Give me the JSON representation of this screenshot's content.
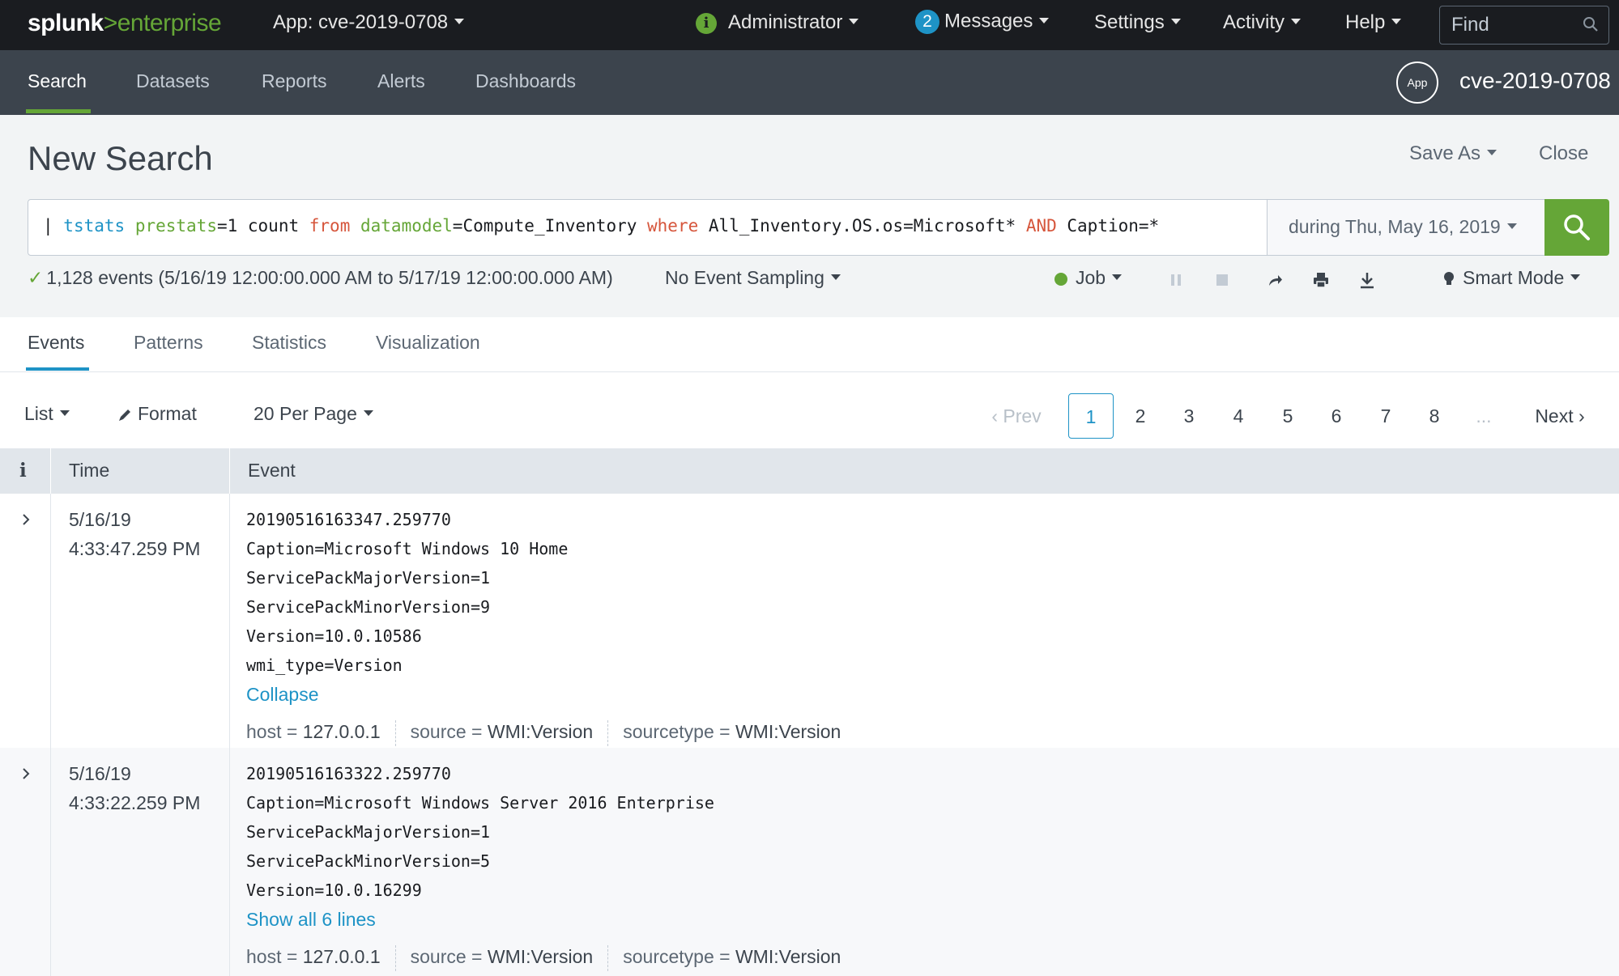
{
  "topbar": {
    "logo_splunk": "splunk",
    "logo_gt": ">",
    "logo_enterprise": "enterprise",
    "app_menu": "App: cve-2019-0708",
    "admin_label": "Administrator",
    "messages_count": "2",
    "messages_label": "Messages",
    "settings_label": "Settings",
    "activity_label": "Activity",
    "help_label": "Help",
    "find_placeholder": "Find"
  },
  "nav": {
    "items": [
      "Search",
      "Datasets",
      "Reports",
      "Alerts",
      "Dashboards"
    ],
    "app_badge": "App",
    "app_name": "cve-2019-0708"
  },
  "search": {
    "title": "New Search",
    "save_as": "Save As",
    "close": "Close",
    "query_tokens": [
      {
        "text": "| ",
        "cls": ""
      },
      {
        "text": "tstats",
        "cls": "kw-blue"
      },
      {
        "text": " ",
        "cls": ""
      },
      {
        "text": "prestats",
        "cls": "kw-green"
      },
      {
        "text": "=1 count ",
        "cls": ""
      },
      {
        "text": "from",
        "cls": "kw-orange"
      },
      {
        "text": " ",
        "cls": ""
      },
      {
        "text": "datamodel",
        "cls": "kw-green"
      },
      {
        "text": "=Compute_Inventory ",
        "cls": ""
      },
      {
        "text": "where",
        "cls": "kw-orange"
      },
      {
        "text": " All_Inventory.OS.os=Microsoft* ",
        "cls": ""
      },
      {
        "text": "AND",
        "cls": "kw-orange"
      },
      {
        "text": " Caption=*",
        "cls": ""
      }
    ],
    "time_range": "during Thu, May 16, 2019",
    "status": "1,128 events (5/16/19 12:00:00.000 AM to 5/17/19 12:00:00.000 AM)",
    "sampling": "No Event Sampling",
    "job": "Job",
    "mode": "Smart Mode"
  },
  "tabs": [
    "Events",
    "Patterns",
    "Statistics",
    "Visualization"
  ],
  "controls": {
    "list": "List",
    "format": "Format",
    "per_page": "20 Per Page",
    "prev": "Prev",
    "pages": [
      "1",
      "2",
      "3",
      "4",
      "5",
      "6",
      "7",
      "8"
    ],
    "ellipsis": "...",
    "next": "Next"
  },
  "table": {
    "col_info": "i",
    "col_time": "Time",
    "col_event": "Event",
    "rows": [
      {
        "date": "5/16/19",
        "time": "4:33:47.259 PM",
        "lines": [
          "20190516163347.259770",
          "Caption=Microsoft Windows 10 Home",
          "ServicePackMajorVersion=1",
          "ServicePackMinorVersion=9",
          "Version=10.0.10586",
          "wmi_type=Version"
        ],
        "link": "Collapse",
        "host_key": "host =",
        "host": "127.0.0.1",
        "source_key": "source =",
        "source": "WMI:Version",
        "sourcetype_key": "sourcetype =",
        "sourcetype": "WMI:Version"
      },
      {
        "date": "5/16/19",
        "time": "4:33:22.259 PM",
        "lines": [
          "20190516163322.259770",
          "Caption=Microsoft Windows Server 2016 Enterprise",
          "ServicePackMajorVersion=1",
          "ServicePackMinorVersion=5",
          "Version=10.0.16299"
        ],
        "link": "Show all 6 lines",
        "host_key": "host =",
        "host": "127.0.0.1",
        "source_key": "source =",
        "source": "WMI:Version",
        "sourcetype_key": "sourcetype =",
        "sourcetype": "WMI:Version"
      }
    ]
  },
  "colors": {
    "accent_green": "#65a637",
    "link_blue": "#1e93c6",
    "topbar_bg": "#1a1c20",
    "navbar_bg": "#3c444d"
  }
}
